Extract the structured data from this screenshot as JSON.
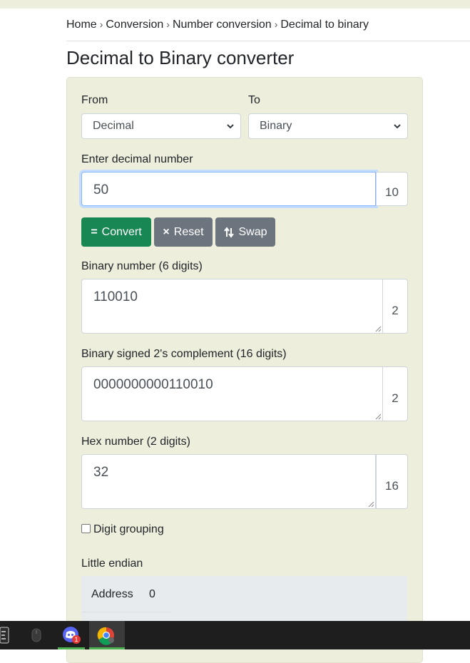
{
  "breadcrumb": {
    "items": [
      "Home",
      "Conversion",
      "Number conversion",
      "Decimal to binary"
    ],
    "separator": "›"
  },
  "page": {
    "title": "Decimal to Binary converter"
  },
  "form": {
    "from_label": "From",
    "from_value": "Decimal",
    "to_label": "To",
    "to_value": "Binary",
    "input_label": "Enter decimal number",
    "input_value": "50",
    "input_base": "10",
    "buttons": {
      "convert": "Convert",
      "convert_glyph": "=",
      "reset": "Reset",
      "reset_glyph": "×",
      "swap": "Swap"
    },
    "binary_label": "Binary number (6 digits)",
    "binary_value": "110010",
    "binary_base": "2",
    "signed_label": "Binary signed 2's complement (16 digits)",
    "signed_value": "0000000000110010",
    "signed_base": "2",
    "hex_label": "Hex number (2 digits)",
    "hex_value": "32",
    "hex_base": "16",
    "digit_grouping_label": "Digit grouping",
    "digit_grouping_checked": false,
    "endian_label": "Little endian",
    "table": {
      "address_header": "Address",
      "address_value": "0"
    }
  },
  "colors": {
    "card_bg": "#eeeedc",
    "convert_btn": "#198754",
    "secondary_btn": "#6c757d",
    "focus_ring": "#86b7fe",
    "taskbar_bg": "#1e1e1e"
  },
  "taskbar": {
    "icons": [
      "epic-games-icon",
      "mouse-app-icon",
      "discord-icon",
      "chrome-icon"
    ],
    "discord_badge": "1"
  }
}
